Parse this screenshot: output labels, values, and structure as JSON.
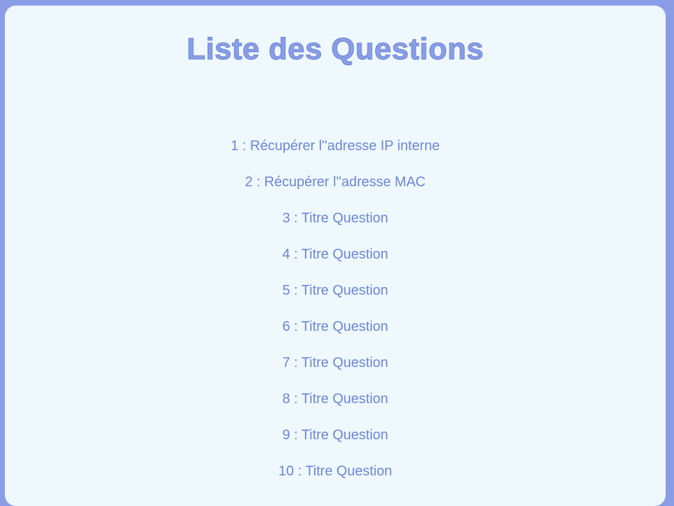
{
  "page": {
    "title": "Liste des Questions"
  },
  "questions": [
    {
      "label": "1 : Récupérer l''adresse IP interne"
    },
    {
      "label": "2 : Récupérer l''adresse MAC"
    },
    {
      "label": "3 : Titre Question"
    },
    {
      "label": "4 : Titre Question"
    },
    {
      "label": "5 : Titre Question"
    },
    {
      "label": "6 : Titre Question"
    },
    {
      "label": "7 : Titre Question"
    },
    {
      "label": "8 : Titre Question"
    },
    {
      "label": "9 : Titre Question"
    },
    {
      "label": "10 : Titre Question"
    }
  ],
  "colors": {
    "background": "#8a9de6",
    "panel": "#eef8fd",
    "accent": "#6d86d8"
  }
}
